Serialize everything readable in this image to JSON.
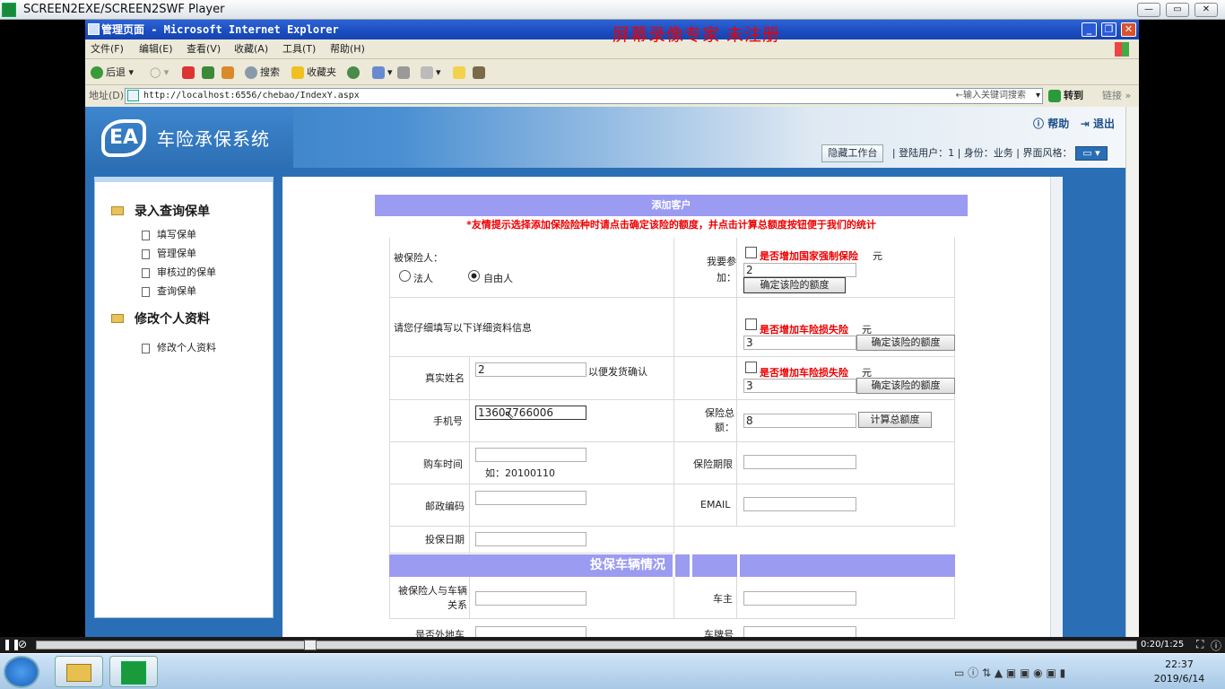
{
  "player": {
    "title": "SCREEN2EXE/SCREEN2SWF Player",
    "time": "0:20/1:25"
  },
  "ie": {
    "title": "管理页面 - Microsoft Internet Explorer",
    "watermark": "屏幕录像专家  未注册",
    "menu": [
      "文件(F)",
      "编辑(E)",
      "查看(V)",
      "收藏(A)",
      "工具(T)",
      "帮助(H)"
    ],
    "toolbar": {
      "back": "后退",
      "search": "搜索",
      "favorites": "收藏夹"
    },
    "address_label": "地址(D)",
    "url": "http://localhost:6556/chebao/IndexY.aspx",
    "search_hint": "←输入关键词搜索",
    "go": "转到",
    "links": "链接"
  },
  "header": {
    "logo": "EA",
    "system": "车险承保系统",
    "help": "帮助",
    "logout": "退出",
    "hide": "隐藏工作台",
    "status": "| 登陆用户：1 | 身份：业务 | 界面风格："
  },
  "sidebar": {
    "sec1": "录入查询保单",
    "sec1_items": [
      "填写保单",
      "管理保单",
      "审核过的保单",
      "查询保单"
    ],
    "sec2": "修改个人资料",
    "sec2_items": [
      "修改个人资料"
    ]
  },
  "form": {
    "title": "添加客户",
    "tip": "*友情提示选择添加保险险种时请点击确定该险的额度，并点击计算总额度按钮便于我们的统计",
    "insured_label": "被保险人：",
    "legal": "法人",
    "natural": "自由人",
    "fill_hint": "请您仔细填写以下详细资料信息",
    "name_label": "真实姓名",
    "name_value": "2",
    "name_note": "以便发货确认",
    "phone_label": "手机号",
    "phone_value": "13607766006",
    "buy_label": "购车时间",
    "buy_note": "如：20100110",
    "zip_label": "邮政编码",
    "date_label": "投保日期",
    "join_label": "我要参加：",
    "ins1": "是否增加国家强制保险",
    "ins1_value": "2",
    "yuan": "元",
    "confirm": "确定该险的额度",
    "ins2": "是否增加车险损失险",
    "ins2_value": "3",
    "ins3": "是否增加车险损失险",
    "ins3_value": "3",
    "total_label": "保险总额：",
    "total_value": "8",
    "calc": "计算总额度",
    "period_label": "保险期限",
    "email_label": "EMAIL",
    "vehicle_title": "投保车辆情况",
    "relation_label": "被保险人与车辆关系",
    "owner_label": "车主",
    "nonlocal_label": "是否外地车",
    "plate_label": "车牌号"
  },
  "taskbar": {
    "time": "22:37",
    "date": "2019/6/14"
  }
}
